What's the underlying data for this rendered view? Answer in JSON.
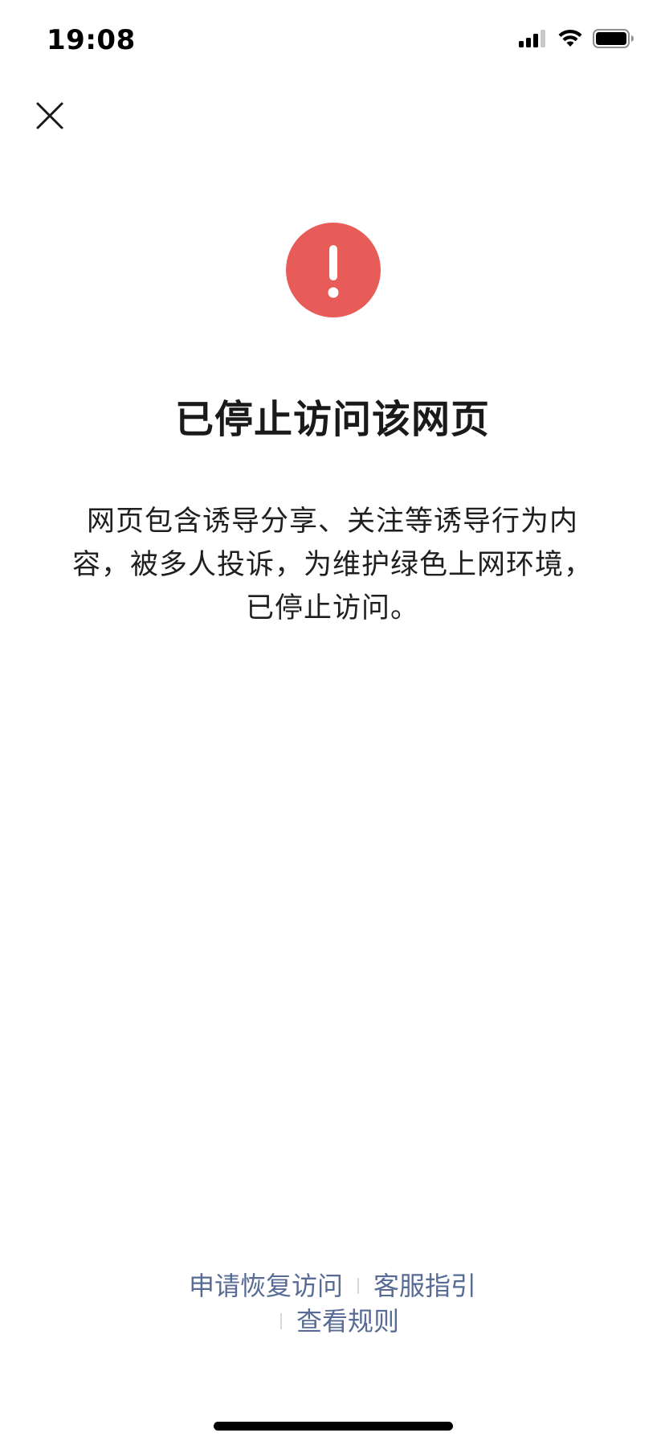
{
  "status_bar": {
    "time": "19:08",
    "icons": [
      "cellular-signal-icon",
      "wifi-icon",
      "battery-icon"
    ]
  },
  "nav": {
    "close_icon": "close-icon"
  },
  "alert": {
    "icon": "exclamation-icon",
    "color": "#e75c58"
  },
  "main": {
    "title": "已停止访问该网页",
    "description": "网页包含诱导分享、关注等诱导行为内容，被多人投诉，为维护绿色上网环境，已停止访问。"
  },
  "footer": {
    "apply_restore": "申请恢复访问",
    "support_guide": "客服指引",
    "view_rules": "查看规则",
    "link_color": "#576b95"
  }
}
